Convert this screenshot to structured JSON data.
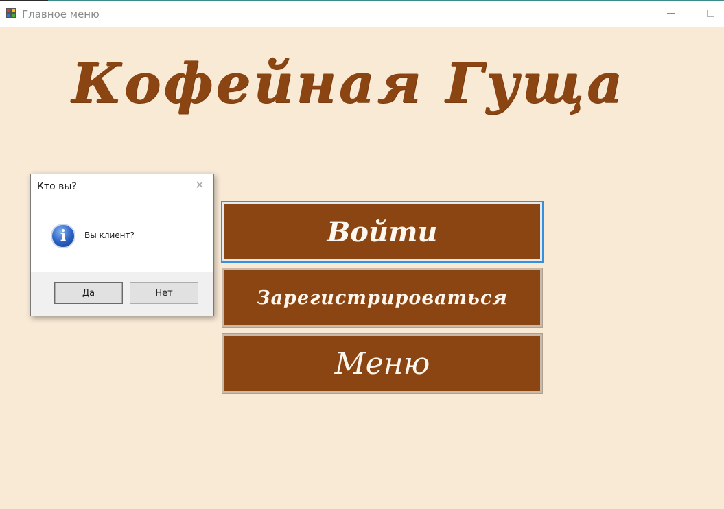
{
  "window": {
    "title": "Главное меню",
    "icon": "app-form-icon"
  },
  "main": {
    "brand_title": "Кофейная Гуща",
    "buttons": {
      "login": "Войти",
      "register": "Зарегистрироваться",
      "menu": "Меню"
    }
  },
  "dialog": {
    "title": "Кто вы?",
    "icon": "info-icon",
    "message": "Вы клиент?",
    "yes_label": "Да",
    "no_label": "Нет"
  },
  "colors": {
    "background": "#f9ead6",
    "brand": "#8b4513",
    "button_text": "#fdf7ef",
    "focus": "#3a8fd8"
  }
}
